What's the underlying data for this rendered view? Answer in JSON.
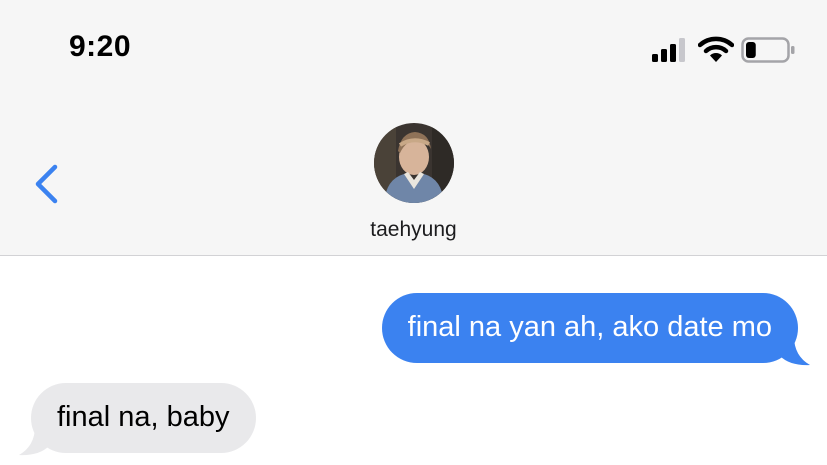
{
  "status_bar": {
    "time": "9:20",
    "signal_icon": "cellular-signal-icon",
    "wifi_icon": "wifi-icon",
    "battery_icon": "battery-icon",
    "battery_level": 0.25
  },
  "nav": {
    "back_icon": "chevron-left-icon",
    "contact_name": "taehyung",
    "avatar": "contact-avatar-photo"
  },
  "messages": [
    {
      "direction": "outgoing",
      "text": "final na yan ah, ako date mo"
    },
    {
      "direction": "incoming",
      "text": "final na, baby"
    }
  ],
  "colors": {
    "outgoing_bubble": "#3b82f0",
    "incoming_bubble": "#e9e9eb",
    "accent": "#3b82f0",
    "header_bg": "#f6f6f6"
  }
}
